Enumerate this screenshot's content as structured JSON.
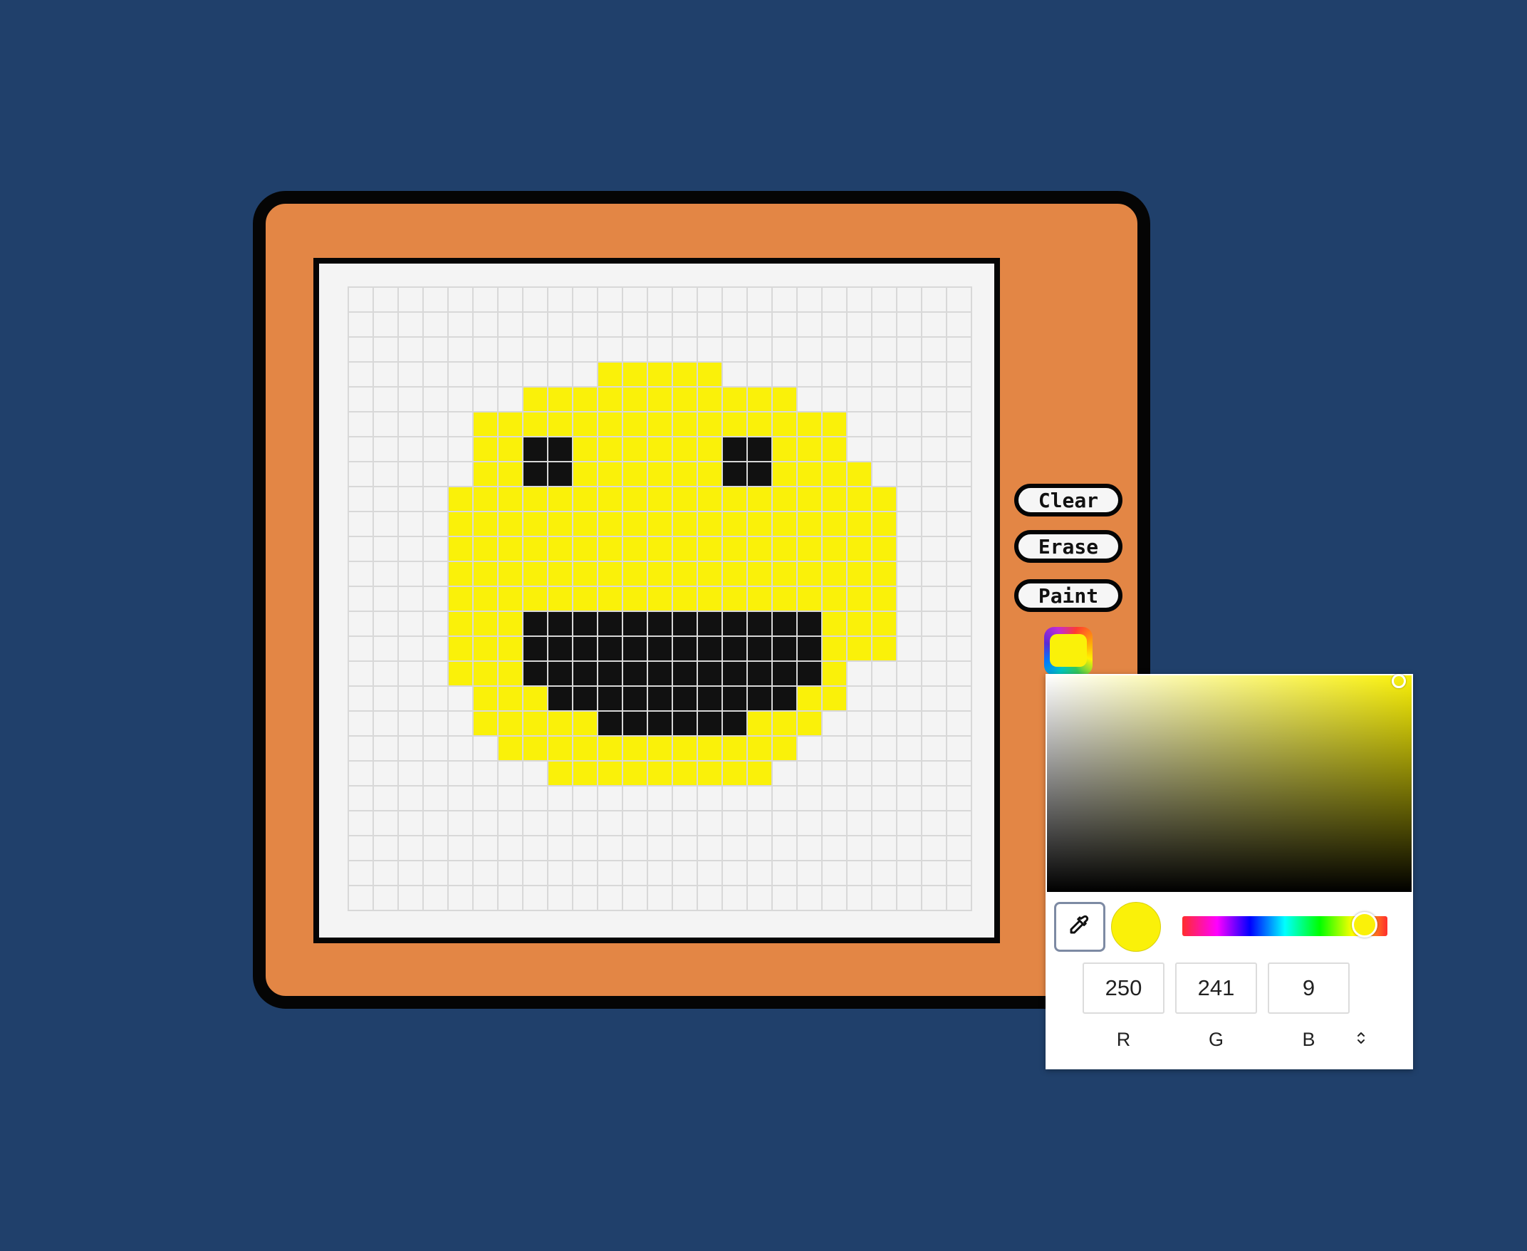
{
  "toolbar": {
    "clear_label": "Clear",
    "erase_label": "Erase",
    "paint_label": "Paint"
  },
  "colors": {
    "background": "#20406b",
    "frame": "#e38645",
    "canvas": "#f4f4f4",
    "paint": "#faf109",
    "ink": "#111111"
  },
  "canvas": {
    "cols": 25,
    "rows": 25,
    "legend": {
      ".": "empty",
      "Y": "yellow",
      "K": "black"
    },
    "pixels": [
      ".........................",
      ".........................",
      ".........................",
      "..........YYYYY..........",
      ".......YYYYYYYYYYY.......",
      ".....YYYYYYYYYYYYYYY.....",
      ".....YYKKYYYYYYKKYYY.....",
      ".....YYKKYYYYYYKKYYYY....",
      "....YYYYYYYYYYYYYYYYYY...",
      "....YYYYYYYYYYYYYYYYYY...",
      "....YYYYYYYYYYYYYYYYYY...",
      "....YYYYYYYYYYYYYYYYYY...",
      "....YYYYYYYYYYYYYYYYYY...",
      "....YYYKKKKKKKKKKKKYYY...",
      "....YYYKKKKKKKKKKKKYYY...",
      "....YYYKKKKKKKKKKKKY.....",
      ".....YYYKKKKKKKKKKYY.....",
      ".....YYYYYKKKKKKYYY......",
      "......YYYYYYYYYYYY.......",
      "........YYYYYYYYY........",
      ".........................",
      ".........................",
      ".........................",
      ".........................",
      "........................."
    ]
  },
  "color_picker": {
    "selected_color": "#faf109",
    "hue_fraction": 0.89,
    "eyedropper_icon": "eyedropper-icon",
    "r": "250",
    "g": "241",
    "b": "9",
    "r_label": "R",
    "g_label": "G",
    "b_label": "B",
    "mode_toggle_icon": "chevron-up-down-icon"
  }
}
